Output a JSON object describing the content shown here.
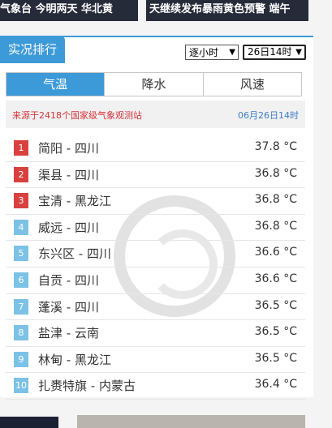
{
  "banners": {
    "left": "气象台 今明两天 华北黄",
    "right": "天继续发布暴雨黄色预警 端午"
  },
  "panel": {
    "title": "实况排行",
    "hour_select": "逐小时",
    "date_select": "26日14时",
    "tabs": [
      "气温",
      "降水",
      "风速"
    ],
    "source_text": "来源于2418个国家级气象观测站",
    "time_text": "06月26日14时"
  },
  "rows": [
    {
      "rank": "1",
      "name": "简阳 - 四川",
      "value": "37.8 °C",
      "color": "#d9413f"
    },
    {
      "rank": "2",
      "name": "渠县 - 四川",
      "value": "36.8 °C",
      "color": "#d9413f"
    },
    {
      "rank": "3",
      "name": "宝清 - 黑龙江",
      "value": "36.8 °C",
      "color": "#d9413f"
    },
    {
      "rank": "4",
      "name": "威远 - 四川",
      "value": "36.8 °C",
      "color": "#7cc2e6"
    },
    {
      "rank": "5",
      "name": "东兴区 - 四川",
      "value": "36.6 °C",
      "color": "#7cc2e6"
    },
    {
      "rank": "6",
      "name": "自贡 - 四川",
      "value": "36.6 °C",
      "color": "#7cc2e6"
    },
    {
      "rank": "7",
      "name": "蓬溪 - 四川",
      "value": "36.5 °C",
      "color": "#7cc2e6"
    },
    {
      "rank": "8",
      "name": "盐津 - 云南",
      "value": "36.5 °C",
      "color": "#7cc2e6"
    },
    {
      "rank": "9",
      "name": "林甸 - 黑龙江",
      "value": "36.5 °C",
      "color": "#7cc2e6"
    },
    {
      "rank": "10",
      "name": "扎赉特旗 - 内蒙古",
      "value": "36.4 °C",
      "color": "#7cc2e6"
    }
  ]
}
